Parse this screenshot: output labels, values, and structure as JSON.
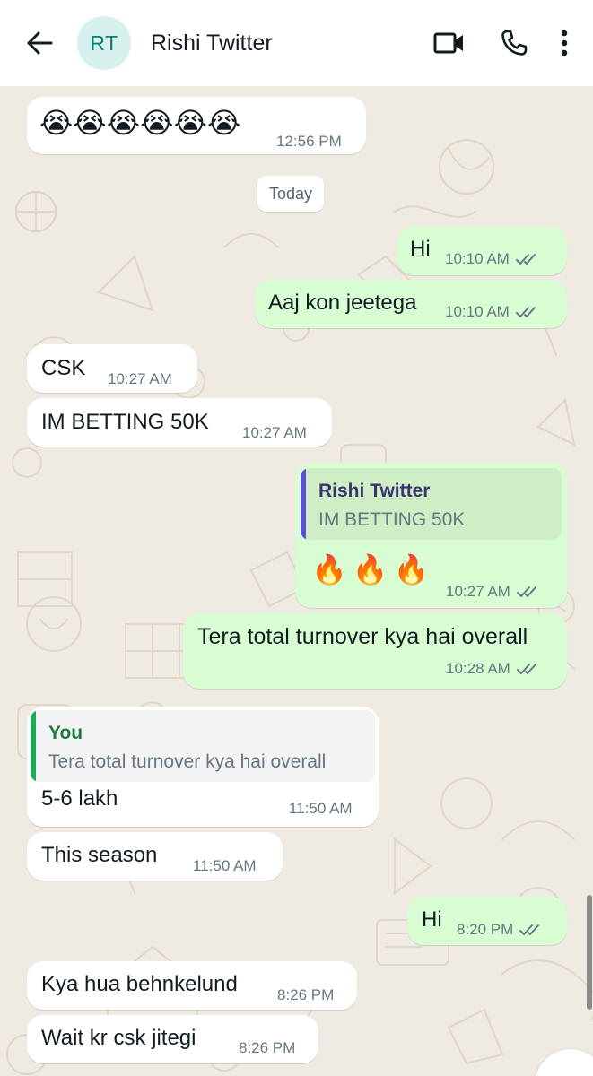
{
  "header": {
    "avatar_initials": "RT",
    "contact_name": "Rishi Twitter",
    "icons": [
      "back-arrow-icon",
      "video-call-icon",
      "voice-call-icon",
      "more-options-icon"
    ]
  },
  "date_chip": "Today",
  "messages": [
    {
      "dir": "in",
      "text": "😭😭😭😭😭😭",
      "time": "12:56 PM"
    },
    {
      "dir": "out",
      "text": "Hi",
      "time": "10:10 AM",
      "status": "read"
    },
    {
      "dir": "out",
      "text": "Aaj kon jeetega",
      "time": "10:10 AM",
      "status": "read"
    },
    {
      "dir": "in",
      "text": "CSK",
      "time": "10:27 AM"
    },
    {
      "dir": "in",
      "text": "IM BETTING 50K",
      "time": "10:27 AM"
    },
    {
      "dir": "out",
      "quote": {
        "name": "Rishi Twitter",
        "text": "IM BETTING 50K"
      },
      "text": "🔥🔥🔥",
      "time": "10:27 AM",
      "status": "read"
    },
    {
      "dir": "out",
      "text": "Tera total turnover kya hai overall",
      "time": "10:28 AM",
      "status": "read"
    },
    {
      "dir": "in",
      "quote": {
        "name": "You",
        "text": "Tera total turnover kya hai overall"
      },
      "text": "5-6 lakh",
      "time": "11:50 AM"
    },
    {
      "dir": "in",
      "text": "This season",
      "time": "11:50 AM"
    },
    {
      "dir": "out",
      "text": "Hi",
      "time": "8:20 PM",
      "status": "read"
    },
    {
      "dir": "in",
      "text": "Kya hua behnkelund",
      "time": "8:26 PM"
    },
    {
      "dir": "in",
      "text": "Wait kr csk jitegi",
      "time": "8:26 PM"
    }
  ],
  "colors": {
    "header_bg": "#ffffff",
    "chat_bg": "#efeae2",
    "incoming_bubble": "#ffffff",
    "outgoing_bubble": "#d9fdd3",
    "read_ticks": "#667781",
    "quote_bar_contact": "#5b4fd6",
    "quote_bar_you": "#1fa855",
    "avatar_bg": "#d6f0ec"
  }
}
